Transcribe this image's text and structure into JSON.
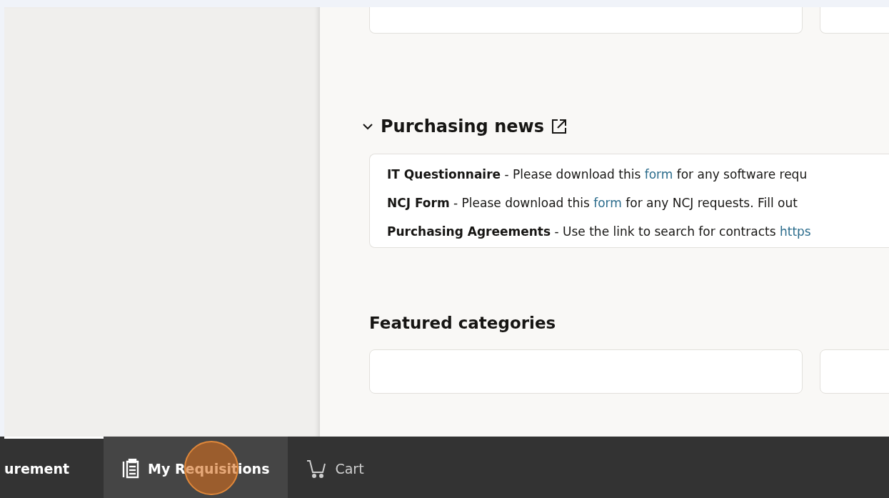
{
  "news": {
    "title": "Purchasing news",
    "expanded": true,
    "items": [
      {
        "title": "IT Questionnaire",
        "before": " - Please download this ",
        "link": "form",
        "after": " for any software requ"
      },
      {
        "title": "NCJ Form",
        "before": " - Please download this ",
        "link": "form",
        "after": " for any NCJ requests. Fill out"
      },
      {
        "title": "Purchasing Agreements",
        "before": " - Use the link to search for contracts ",
        "link": "https"
      }
    ]
  },
  "featured": {
    "title": "Featured categories"
  },
  "nav": [
    {
      "label": "urement",
      "kind": "plain",
      "selected": true,
      "hovered": false
    },
    {
      "label": "My Requisitions",
      "kind": "requisitions",
      "selected": false,
      "hovered": true
    },
    {
      "label": "Cart",
      "kind": "cart",
      "selected": false,
      "hovered": false
    }
  ]
}
